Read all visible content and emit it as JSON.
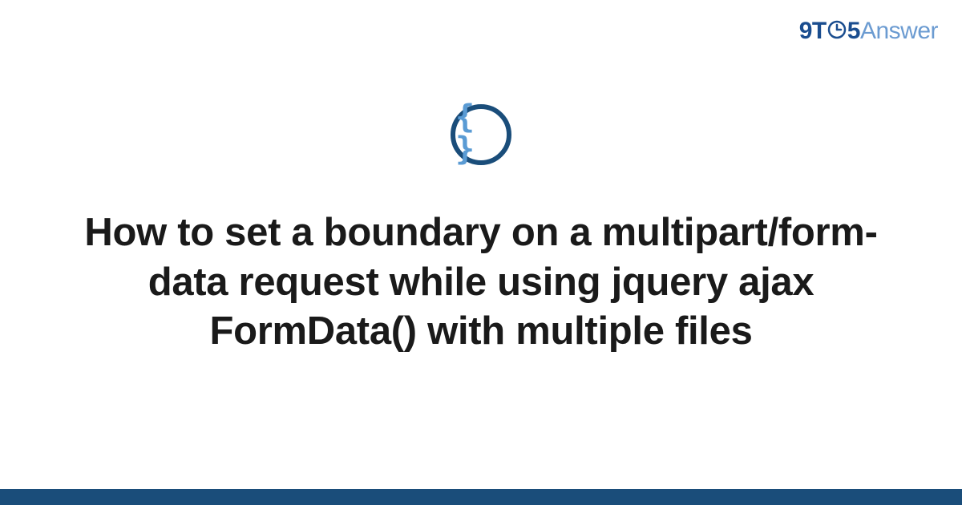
{
  "brand": {
    "part1": "9T",
    "part2": "5",
    "part3": "Answer"
  },
  "icon": {
    "content": "{ }",
    "name": "code-braces-icon"
  },
  "title": "How to set a boundary on a multipart/form-data request while using jquery ajax FormData() with multiple files",
  "colors": {
    "darkBlue": "#1a4d7a",
    "brandBlue": "#1a4d8f",
    "lightBlue": "#6b9bd1",
    "iconBlue": "#5a9bd4"
  }
}
